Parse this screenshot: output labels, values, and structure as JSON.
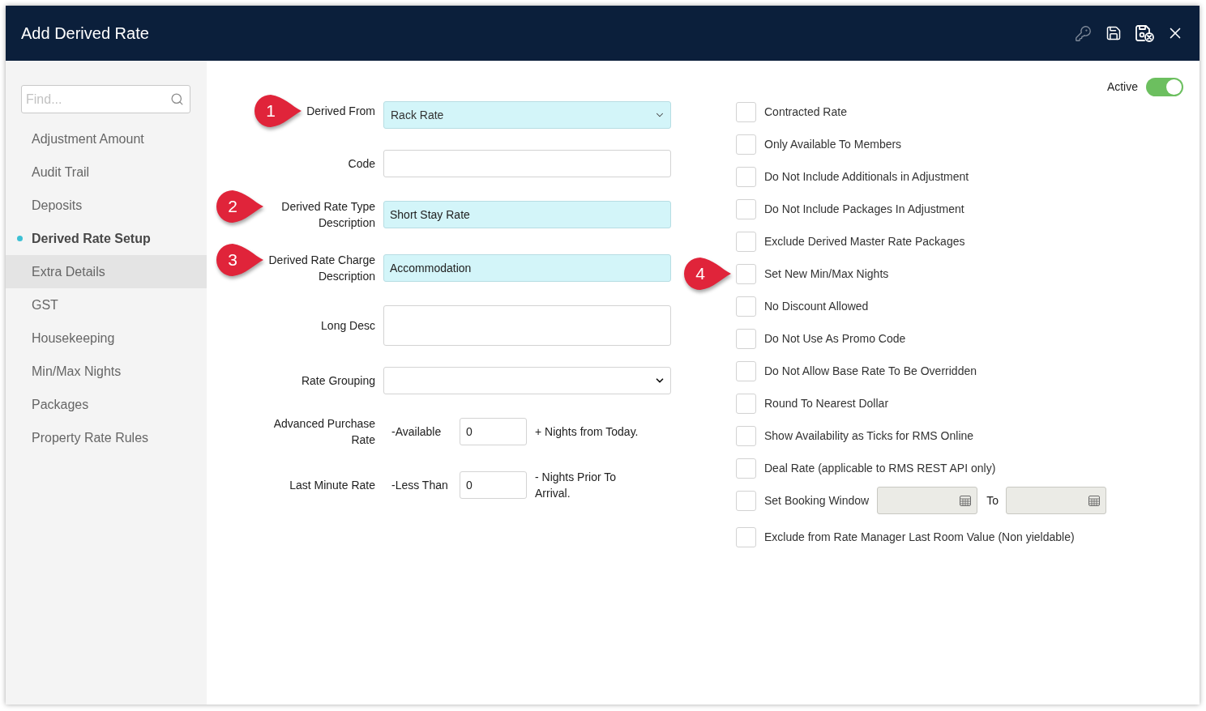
{
  "window": {
    "title": "Add Derived Rate"
  },
  "toolbar": [
    {
      "kind": "key",
      "disabled": true
    },
    {
      "kind": "save",
      "disabled": false
    },
    {
      "kind": "save_close",
      "disabled": false
    },
    {
      "kind": "close",
      "disabled": false
    }
  ],
  "sidebar": {
    "search": {
      "placeholder": "Find..."
    },
    "items": [
      {
        "label": "Adjustment Amount",
        "selected": false,
        "hovered": false
      },
      {
        "label": "Audit Trail",
        "selected": false,
        "hovered": false
      },
      {
        "label": "Deposits",
        "selected": false,
        "hovered": false
      },
      {
        "label": "Derived Rate Setup",
        "selected": true,
        "hovered": false
      },
      {
        "label": "Extra Details",
        "selected": false,
        "hovered": true
      },
      {
        "label": "GST",
        "selected": false,
        "hovered": false
      },
      {
        "label": "Housekeeping",
        "selected": false,
        "hovered": false
      },
      {
        "label": "Min/Max Nights",
        "selected": false,
        "hovered": false
      },
      {
        "label": "Packages",
        "selected": false,
        "hovered": false
      },
      {
        "label": "Property Rate Rules",
        "selected": false,
        "hovered": false
      }
    ]
  },
  "form": {
    "fields": [
      {
        "kind": "select",
        "label": "Derived From",
        "value": "Rack Rate",
        "highlighted": true,
        "callout": "1"
      },
      {
        "kind": "text",
        "label": "Code",
        "highlighted": false
      },
      {
        "kind": "text",
        "label": "Derived Rate Type Description",
        "value": "Short Stay Rate",
        "highlighted": true,
        "callout": "2"
      },
      {
        "kind": "text",
        "label": "Derived Rate Charge Description",
        "value": "Accommodation",
        "highlighted": true,
        "callout": "3"
      },
      {
        "kind": "textarea",
        "label": "Long Desc",
        "highlighted": false
      },
      {
        "kind": "select",
        "label": "Rate Grouping",
        "highlighted": false
      },
      {
        "kind": "nights",
        "label": "Advanced Purchase Rate",
        "prefix": "-Available",
        "value": "0",
        "suffix": "+ Nights from Today."
      },
      {
        "kind": "nights",
        "label": "Last Minute Rate",
        "prefix": "-Less Than",
        "value": "0",
        "suffix": "- Nights Prior To Arrival."
      }
    ]
  },
  "active_toggle": {
    "label": "Active",
    "on": true
  },
  "options": [
    {
      "kind": "checkbox",
      "label": "Contracted Rate",
      "checked": false
    },
    {
      "kind": "checkbox",
      "label": "Only Available To Members",
      "checked": false
    },
    {
      "kind": "checkbox",
      "label": "Do Not Include Additionals in Adjustment",
      "checked": false
    },
    {
      "kind": "checkbox",
      "label": "Do Not Include Packages In Adjustment",
      "checked": false
    },
    {
      "kind": "checkbox",
      "label": "Exclude Derived Master Rate Packages",
      "checked": false
    },
    {
      "kind": "checkbox",
      "label": "Set New Min/Max Nights",
      "checked": false,
      "callout": "4"
    },
    {
      "kind": "checkbox",
      "label": "No Discount Allowed",
      "checked": false
    },
    {
      "kind": "checkbox",
      "label": "Do Not Use As Promo Code",
      "checked": false
    },
    {
      "kind": "checkbox",
      "label": "Do Not Allow Base Rate To Be Overridden",
      "checked": false
    },
    {
      "kind": "checkbox",
      "label": "Round To Nearest Dollar",
      "checked": false
    },
    {
      "kind": "checkbox",
      "label": "Show Availability as Ticks for RMS Online",
      "checked": false
    },
    {
      "kind": "checkbox",
      "label": "Deal Rate (applicable to RMS REST API only)",
      "checked": false
    },
    {
      "kind": "date_range",
      "label": "Set Booking Window",
      "checked": false,
      "to_label": "To"
    },
    {
      "kind": "checkbox",
      "label": "Exclude from Rate Manager Last Room Value (Non yieldable)",
      "checked": false
    }
  ]
}
